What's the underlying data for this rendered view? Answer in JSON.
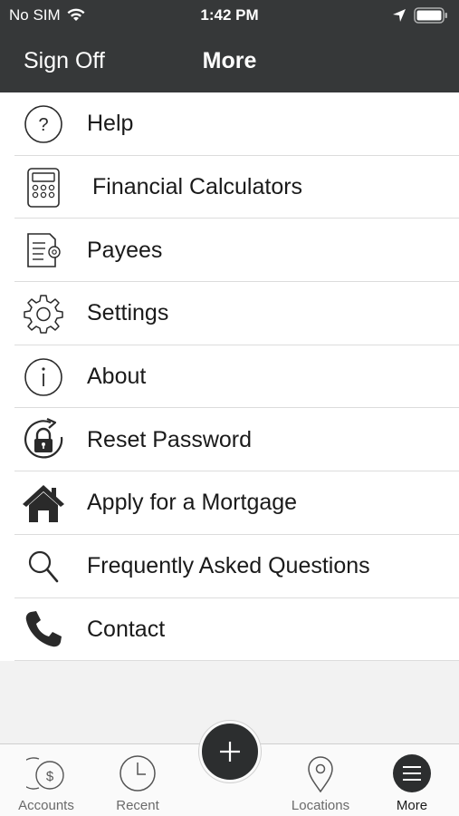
{
  "status": {
    "carrier": "No SIM",
    "time": "1:42 PM"
  },
  "nav": {
    "sign_off": "Sign Off",
    "title": "More"
  },
  "menu": [
    {
      "label": "Help",
      "icon": "help-icon"
    },
    {
      "label": "Financial Calculators",
      "icon": "calculator-icon"
    },
    {
      "label": "Payees",
      "icon": "payees-icon"
    },
    {
      "label": "Settings",
      "icon": "gear-icon"
    },
    {
      "label": "About",
      "icon": "info-icon"
    },
    {
      "label": "Reset Password",
      "icon": "reset-lock-icon"
    },
    {
      "label": "Apply for a Mortgage",
      "icon": "house-icon"
    },
    {
      "label": "Frequently Asked Questions",
      "icon": "search-icon"
    },
    {
      "label": "Contact",
      "icon": "phone-icon"
    }
  ],
  "tabs": [
    {
      "label": "Accounts",
      "icon": "accounts-icon"
    },
    {
      "label": "Recent",
      "icon": "clock-icon"
    },
    {
      "label": "Locations",
      "icon": "location-pin-icon"
    },
    {
      "label": "More",
      "icon": "menu-icon",
      "active": true
    }
  ],
  "colors": {
    "header_bg": "#363839",
    "fab_bg": "#2c2e2f"
  }
}
